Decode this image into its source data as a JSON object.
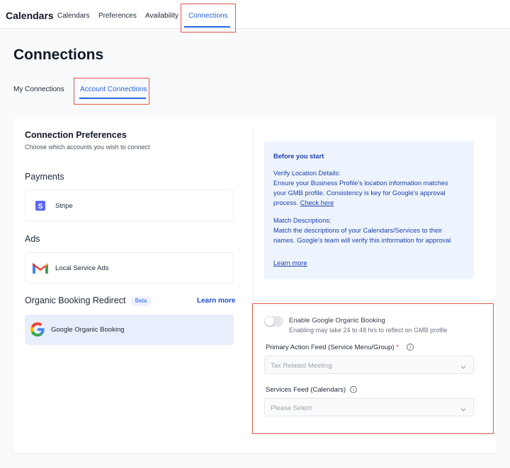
{
  "nav": {
    "app_title": "Calendars",
    "items": [
      "Calendars",
      "Preferences",
      "Availability",
      "Connections"
    ],
    "active": "Connections"
  },
  "page": {
    "title": "Connections"
  },
  "subtabs": {
    "items": [
      "My Connections",
      "Account Connections"
    ],
    "active": "Account Connections"
  },
  "prefs": {
    "title": "Connection Preferences",
    "subtitle": "Choose which accounts you wish to connect",
    "payments": {
      "heading": "Payments",
      "stripe_label": "Stripe",
      "stripe_icon": "stripe-icon"
    },
    "ads": {
      "heading": "Ads",
      "lsa_label": "Local Service Ads",
      "lsa_icon": "gmail-m-icon"
    },
    "organic": {
      "heading": "Organic Booking Redirect",
      "badge": "Beta",
      "learn_more": "Learn more",
      "google_label": "Google Organic Booking",
      "google_icon": "google-g-icon"
    }
  },
  "info": {
    "title": "Before you start",
    "verify_title": "Verify Location Details:",
    "verify_l1": "Ensure your Business Profile's location information matches",
    "verify_l2": "your GMB profile. Consistency is key for Google's approval",
    "verify_l3": "process.",
    "check_here": "Check here",
    "match_title": "Match Descriptions:",
    "match_l1": "Match the descriptions of your Calendars/Services to their",
    "match_l2": "names. Google's team will verify this information for approval",
    "learn_more": "Learn more"
  },
  "organic_form": {
    "toggle_label": "Enable Google Organic Booking",
    "toggle_enabled": false,
    "toggle_sub": "Enabling may take 24 to 48 hrs to reflect on GMB profile",
    "primary_label": "Primary Action Feed (Service Menu/Group)",
    "primary_required": "*",
    "primary_value": "Tax Related Meeting",
    "services_label": "Services Feed (Calendars)",
    "services_placeholder": "Please Select"
  },
  "colors": {
    "accent": "#2563eb",
    "highlight": "#e4574a",
    "info_bg": "#eef4fd"
  }
}
